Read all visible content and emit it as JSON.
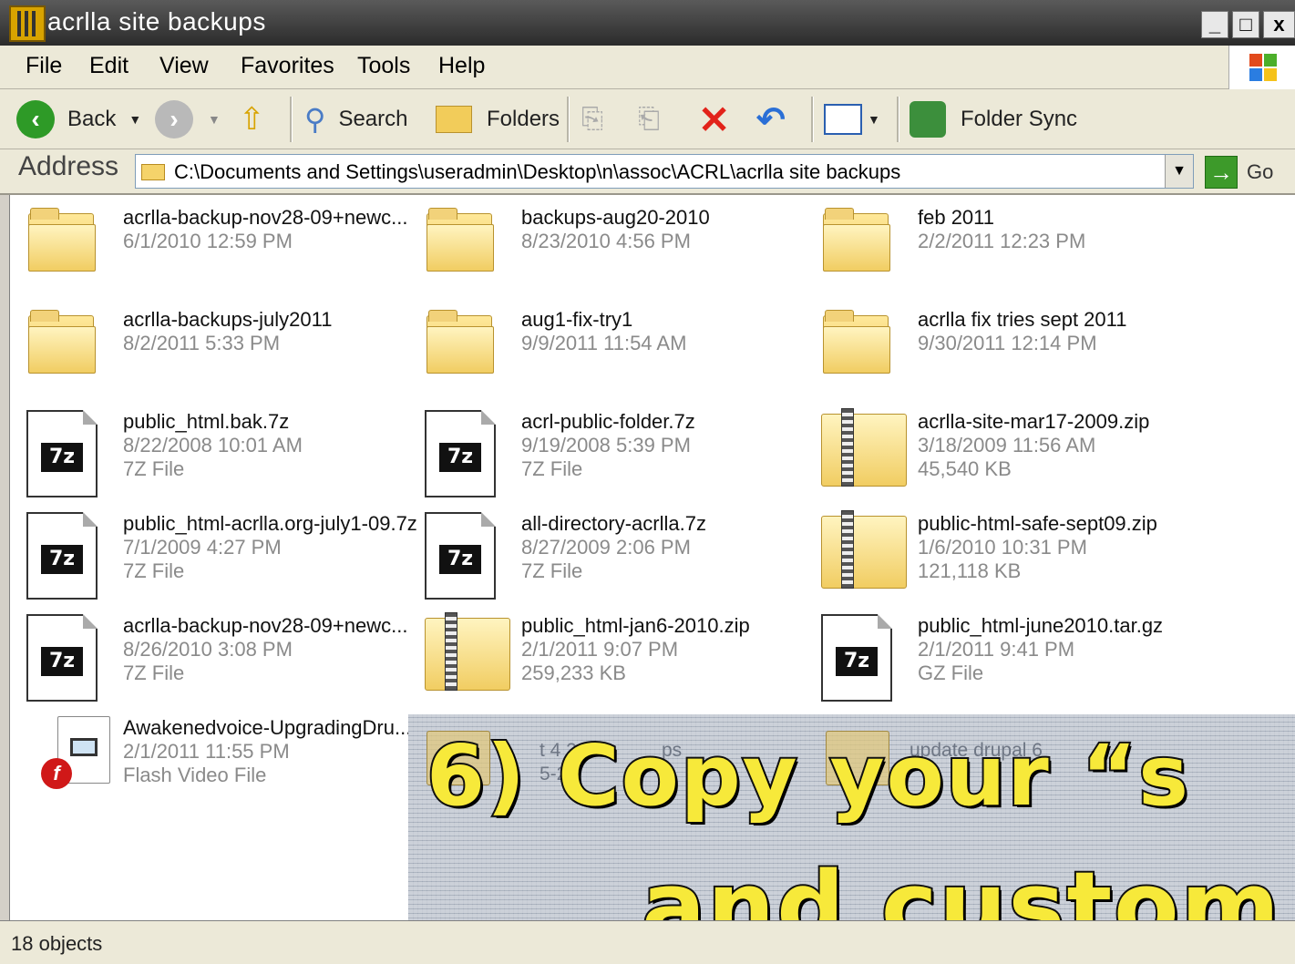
{
  "window": {
    "title": "acrlla site backups",
    "buttons": {
      "minimize": "_",
      "maximize": "□",
      "close": "x"
    }
  },
  "menubar": {
    "items": [
      "File",
      "Edit",
      "View",
      "Favorites",
      "Tools",
      "Help"
    ]
  },
  "toolbar": {
    "back_label": "Back",
    "search_label": "Search",
    "folders_label": "Folders",
    "folder_sync_label": "Folder Sync"
  },
  "address": {
    "label": "Address",
    "path": "C:\\Documents and Settings\\useradmin\\Desktop\\n\\assoc\\ACRL\\acrlla site backups",
    "go_label": "Go"
  },
  "files": [
    {
      "icon": "folder-icon",
      "name": "acrlla-backup-nov28-09+newc...",
      "line2": "6/1/2010 12:59 PM",
      "line3": ""
    },
    {
      "icon": "folder-icon",
      "name": "backups-aug20-2010",
      "line2": "8/23/2010 4:56 PM",
      "line3": ""
    },
    {
      "icon": "folder-icon",
      "name": "feb 2011",
      "line2": "2/2/2011 12:23 PM",
      "line3": ""
    },
    {
      "icon": "folder-icon",
      "name": "acrlla-backups-july2011",
      "line2": "8/2/2011 5:33 PM",
      "line3": ""
    },
    {
      "icon": "folder-icon",
      "name": "aug1-fix-try1",
      "line2": "9/9/2011 11:54 AM",
      "line3": ""
    },
    {
      "icon": "folder-icon",
      "name": "acrlla fix tries sept 2011",
      "line2": "9/30/2011 12:14 PM",
      "line3": ""
    },
    {
      "icon": "7z-file-icon",
      "name": "public_html.bak.7z",
      "line2": "8/22/2008 10:01 AM",
      "line3": "7Z File"
    },
    {
      "icon": "7z-file-icon",
      "name": "acrl-public-folder.7z",
      "line2": "9/19/2008 5:39 PM",
      "line3": "7Z File"
    },
    {
      "icon": "zip-file-icon",
      "name": "acrlla-site-mar17-2009.zip",
      "line2": "3/18/2009 11:56 AM",
      "line3": "45,540 KB"
    },
    {
      "icon": "7z-file-icon",
      "name": "public_html-acrlla.org-july1-09.7z",
      "line2": "7/1/2009 4:27 PM",
      "line3": "7Z File"
    },
    {
      "icon": "7z-file-icon",
      "name": "all-directory-acrlla.7z",
      "line2": "8/27/2009 2:06 PM",
      "line3": "7Z File"
    },
    {
      "icon": "zip-file-icon",
      "name": "public-html-safe-sept09.zip",
      "line2": "1/6/2010 10:31 PM",
      "line3": "121,118 KB"
    },
    {
      "icon": "7z-file-icon",
      "name": "acrlla-backup-nov28-09+newc...",
      "line2": "8/26/2010 3:08 PM",
      "line3": "7Z File"
    },
    {
      "icon": "zip-file-icon",
      "name": "public_html-jan6-2010.zip",
      "line2": "2/1/2011 9:07 PM",
      "line3": "259,233 KB"
    },
    {
      "icon": "gz-file-icon",
      "name": "public_html-june2010.tar.gz",
      "line2": "2/1/2011 9:41 PM",
      "line3": "GZ File"
    },
    {
      "icon": "flash-video-icon",
      "name": "Awakenedvoice-UpgradingDru...",
      "line2": "2/1/2011 11:55 PM",
      "line3": "Flash Video File"
    }
  ],
  "obscured": {
    "item1_line1": "t 4 20",
    "item1_tail": "ps",
    "item1_line2": "5-2",
    "item2_name": "update drupal 6"
  },
  "status": {
    "objects": "18 objects"
  },
  "caption": {
    "line1": "6) Copy your “s",
    "line2": "and custom"
  },
  "colors": {
    "caption_fill": "#f7e93a",
    "caption_stroke": "#101010",
    "title_bg": "#3a3a3a"
  }
}
